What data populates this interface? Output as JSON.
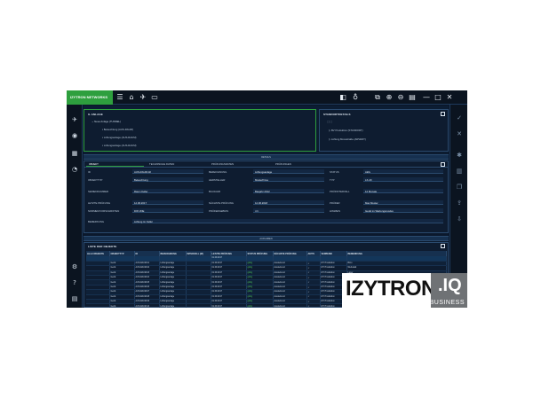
{
  "app": {
    "logo_text": "IZYTRON NETWORKS"
  },
  "colors": {
    "accent": "#2e9f3e",
    "background": "#0a1628",
    "panel": "#0e1c30"
  },
  "topbar": {
    "icons": [
      "menu-icon",
      "home-icon",
      "rocket-icon",
      "screen-icon",
      "sidebar-toggle-icon",
      "lightbulb-icon",
      "export-icon",
      "zoom-in-icon",
      "zoom-out-icon",
      "window-icon",
      "minimize-icon",
      "maximize-icon",
      "close-icon"
    ]
  },
  "tree_panel": {
    "title": "IL ANLAGE",
    "items": [
      {
        "label": "Neue Anlage (TUNNEL)"
      },
      {
        "label": "Beleuchtung (AUS-RAUM)"
      },
      {
        "label": "Lüftungsanlage (AUS-RAUM)"
      },
      {
        "label": "Lüftungsanlage (AUS-RAUM)"
      }
    ]
  },
  "location_panel": {
    "title": "STANDORTDETAILS",
    "items": [
      {
        "label": "BV Produktion (STANDORT)"
      },
      {
        "label": "Lüftung Moosstraße (ARVENT)"
      }
    ]
  },
  "separator_1": "DETAILS",
  "tabs": [
    "OBJEKT",
    "TECHNISCHE DATEN",
    "PRÜFUNGSDATEN",
    "PRÜFUNGEN"
  ],
  "form": {
    "rows": [
      [
        {
          "label": "ID",
          "value": "AUS-RAUM-02"
        },
        {
          "label": "BEZEICHNUNG",
          "value": "Lüftungsanlage"
        },
        {
          "label": "STATUS",
          "value": "Aktiv"
        }
      ],
      [
        {
          "label": "OBJEKTTYP",
          "value": "Beleuchtung"
        },
        {
          "label": "HERSTELLER",
          "value": "Musterfirma"
        },
        {
          "label": "TYP",
          "value": "LX-20"
        }
      ],
      [
        {
          "label": "SERIENNUMMER",
          "value": "Raum Keller"
        },
        {
          "label": "BAUJAHR",
          "value": "Baujahr 2012"
        },
        {
          "label": "PRÜFINTERVALL",
          "value": "12 Monate"
        }
      ],
      [
        {
          "label": "LETZTE PRÜFUNG",
          "value": "12.06.2017"
        },
        {
          "label": "NÄCHSTE PRÜFUNG",
          "value": "12.06.2018"
        },
        {
          "label": "PRÜFER",
          "value": "Max Muster"
        }
      ],
      [
        {
          "label": "NORMEN/VORSCHRIFTEN",
          "value": "DIN VDE"
        },
        {
          "label": "PRÜFERGEBNIS",
          "value": "i.O."
        },
        {
          "label": "HINWEIS",
          "value": "Gerät im Wartungsmodus"
        }
      ]
    ],
    "notes_label": "BEMERKUNG",
    "notes_value": "Lüftung im Keller"
  },
  "separator_2": "AUFGABEN",
  "list": {
    "title": "LISTE DER OBJEKTE",
    "columns": [
      "ALLE OBJEKTE",
      "OBJEKTTYP",
      "ID",
      "BEZEICHNUNG",
      "INTERVALL (M)",
      "LETZTE PRÜFUNG",
      "STATUS PRÜFUNG",
      "NÄCHSTE PRÜFUNG",
      "AKTIV",
      "VERBUND",
      "BEMERKUNG"
    ],
    "rows": [
      [
        "",
        "",
        "",
        "",
        "",
        "01.09.2017",
        "",
        "",
        "",
        "",
        ""
      ],
      [
        "",
        "Gerät",
        "AUS-RAUM-01",
        "Lüftungsanlage",
        "",
        "01.09.2017",
        "gültig",
        "Ausstehend",
        "✓",
        "IZY Produktion",
        "Büro"
      ],
      [
        "",
        "Gerät",
        "AUS-RAUM-02",
        "Lüftungsanlage",
        "",
        "01.09.2017",
        "gültig",
        "Ausstehend",
        "✓",
        "IZY Produktion",
        "Werkstatt"
      ],
      [
        "",
        "Gerät",
        "AUS-RAUM-03",
        "Lüftungsanlage",
        "",
        "01.09.2017",
        "gültig",
        "Ausstehend",
        "✓",
        "IZY Produktion",
        "Lager"
      ],
      [
        "",
        "Gerät",
        "AUS-RAUM-04",
        "Lüftungsanlage",
        "",
        "01.09.2017",
        "gültig",
        "Ausstehend",
        "✓",
        "IZY Produktion",
        "Halle"
      ],
      [
        "",
        "Gerät",
        "AUS-RAUM-05",
        "Lüftungsanlage",
        "",
        "01.09.2017",
        "gültig",
        "Ausstehend",
        "✓",
        "IZY Produktion",
        "Büro"
      ],
      [
        "",
        "Gerät",
        "AUS-RAUM-06",
        "Lüftungsanlage",
        "",
        "01.09.2017",
        "gültig",
        "Ausstehend",
        "✓",
        "IZY Produktion",
        "Keller"
      ],
      [
        "",
        "Gerät",
        "AUS-RAUM-07",
        "Lüftungsanlage",
        "",
        "01.09.2017",
        "gültig",
        "Ausstehend",
        "✓",
        "IZY Produktion",
        "Halle"
      ],
      [
        "",
        "Gerät",
        "AUS-RAUM-08",
        "Lüftungsanlage",
        "",
        "01.09.2017",
        "gültig",
        "Ausstehend",
        "✓",
        "IZY Produktion",
        "Büro"
      ],
      [
        "",
        "Gerät",
        "AUS-RAUM-09",
        "Lüftungsanlage",
        "",
        "01.09.2017",
        "gültig",
        "Ausstehend",
        "✓",
        "IZY Produktion",
        "Lager"
      ],
      [
        "",
        "Gerät",
        "AUS-RAUM-10",
        "Lüftungsanlage",
        "",
        "01.09.2017",
        "gültig",
        "Ausstehend",
        "✓",
        "IZY Produktion",
        "Werkstatt"
      ]
    ]
  },
  "watermark": {
    "main": "IZYTRON",
    "suffix": ".IQ",
    "sub": "BUSINESS"
  }
}
